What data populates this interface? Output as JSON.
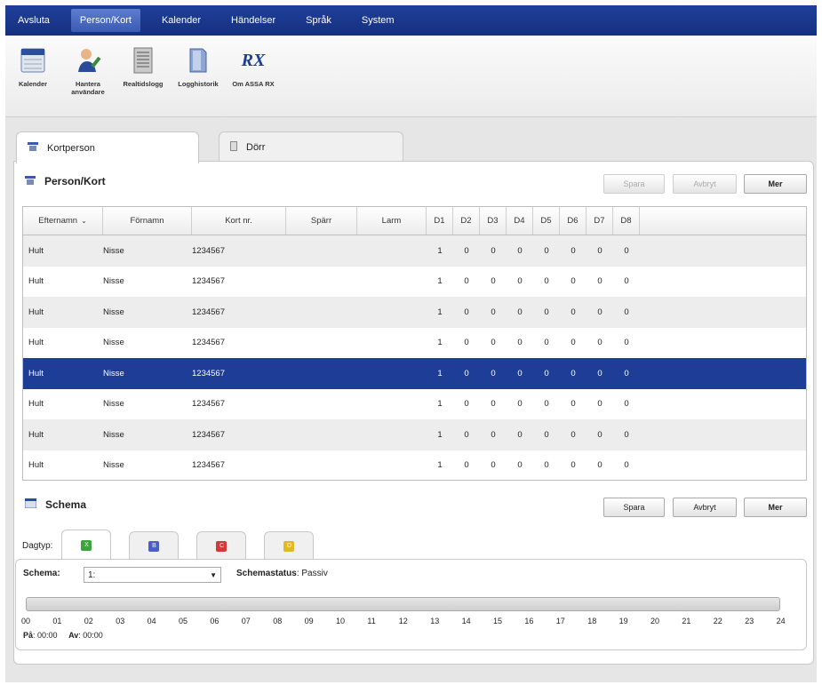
{
  "menu": [
    "Avsluta",
    "Person/Kort",
    "Kalender",
    "Händelser",
    "Språk",
    "System"
  ],
  "toolbar": [
    {
      "label1": "Kalender",
      "label2": "",
      "icon": "calendar-icon"
    },
    {
      "label1": "Hantera",
      "label2": "användare",
      "icon": "user-manage-icon"
    },
    {
      "label1": "Realtidslogg",
      "label2": "",
      "icon": "log-icon"
    },
    {
      "label1": "Logghistorik",
      "label2": "",
      "icon": "history-icon"
    },
    {
      "label1": "Om ASSA RX",
      "label2": "",
      "icon": "rx-logo-icon"
    }
  ],
  "rx_logo": "RX",
  "tabs": {
    "kortperson": "Kortperson",
    "dorr": "Dörr"
  },
  "person": {
    "title": "Person/Kort",
    "buttons": {
      "spara": "Spara",
      "avbryt": "Avbryt",
      "mer": "Mer"
    },
    "columns": [
      "Efternamn",
      "Förnamn",
      "Kort nr.",
      "Spärr",
      "Larm",
      "D1",
      "D2",
      "D3",
      "D4",
      "D5",
      "D6",
      "D7",
      "D8"
    ],
    "sort_indicator": "⌄",
    "rows": [
      {
        "efternamn": "Hult",
        "fornamn": "Nisse",
        "kort": "1234567",
        "d": [
          "1",
          "0",
          "0",
          "0",
          "0",
          "0",
          "0",
          "0"
        ]
      },
      {
        "efternamn": "Hult",
        "fornamn": "Nisse",
        "kort": "1234567",
        "d": [
          "1",
          "0",
          "0",
          "0",
          "0",
          "0",
          "0",
          "0"
        ]
      },
      {
        "efternamn": "Hult",
        "fornamn": "Nisse",
        "kort": "1234567",
        "d": [
          "1",
          "0",
          "0",
          "0",
          "0",
          "0",
          "0",
          "0"
        ]
      },
      {
        "efternamn": "Hult",
        "fornamn": "Nisse",
        "kort": "1234567",
        "d": [
          "1",
          "0",
          "0",
          "0",
          "0",
          "0",
          "0",
          "0"
        ]
      },
      {
        "efternamn": "Hult",
        "fornamn": "Nisse",
        "kort": "1234567",
        "d": [
          "1",
          "0",
          "0",
          "0",
          "0",
          "0",
          "0",
          "0"
        ]
      },
      {
        "efternamn": "Hult",
        "fornamn": "Nisse",
        "kort": "1234567",
        "d": [
          "1",
          "0",
          "0",
          "0",
          "0",
          "0",
          "0",
          "0"
        ]
      },
      {
        "efternamn": "Hult",
        "fornamn": "Nisse",
        "kort": "1234567",
        "d": [
          "1",
          "0",
          "0",
          "0",
          "0",
          "0",
          "0",
          "0"
        ]
      },
      {
        "efternamn": "Hult",
        "fornamn": "Nisse",
        "kort": "1234567",
        "d": [
          "1",
          "0",
          "0",
          "0",
          "0",
          "0",
          "0",
          "0"
        ]
      }
    ]
  },
  "schema": {
    "title": "Schema",
    "buttons": {
      "spara": "Spara",
      "avbryt": "Avbryt",
      "mer": "Mer"
    },
    "daytype_label": "Dagtyp:",
    "daytypes": [
      {
        "color": "#3aa53a",
        "glyph": "X"
      },
      {
        "color": "#4a5fc4",
        "glyph": "B"
      },
      {
        "color": "#d23a3a",
        "glyph": "C"
      },
      {
        "color": "#e0b828",
        "glyph": "D"
      }
    ],
    "schema_label": "Schema:",
    "schema_value": "1:",
    "status_label": "Schemastatus",
    "status_value": "Passiv",
    "hours": [
      "00",
      "01",
      "02",
      "03",
      "04",
      "05",
      "06",
      "07",
      "08",
      "09",
      "10",
      "11",
      "12",
      "13",
      "14",
      "15",
      "16",
      "17",
      "18",
      "19",
      "20",
      "21",
      "22",
      "23",
      "24"
    ],
    "pa_label": "På",
    "pa_value": "00:00",
    "av_label": "Av",
    "av_value": "00:00"
  },
  "colors": {
    "menubar": "#1a3889",
    "selected_row": "#1d3d97"
  }
}
